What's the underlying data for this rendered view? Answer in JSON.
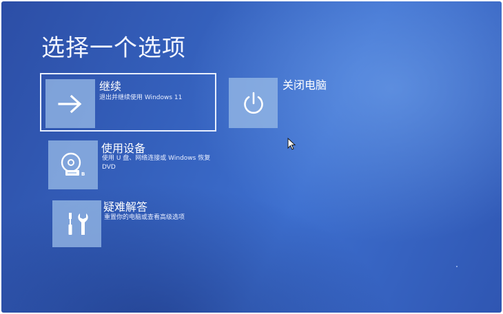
{
  "screen": {
    "title": "选择一个选项"
  },
  "options": [
    {
      "id": "continue",
      "label": "继续",
      "description": "退出并继续使用 Windows 11",
      "icon": "arrow-right-icon",
      "selected": true
    },
    {
      "id": "shutdown",
      "label": "关闭电脑",
      "icon": "power-icon"
    },
    {
      "id": "use-device",
      "label": "使用设备",
      "description": "使用 U 盘、网络连接或 Windows 恢复 DVD",
      "icon": "disc-drive-icon"
    },
    {
      "id": "troubleshoot",
      "label": "疑难解答",
      "description": "重置你的电脑或查看高级选项",
      "icon": "tools-icon"
    }
  ],
  "colors": {
    "background": "#3561bd",
    "tile": "#96b9e6",
    "selection_border": "#e8efff",
    "text": "#ffffff"
  },
  "cursor_icon": "mouse-pointer-icon"
}
